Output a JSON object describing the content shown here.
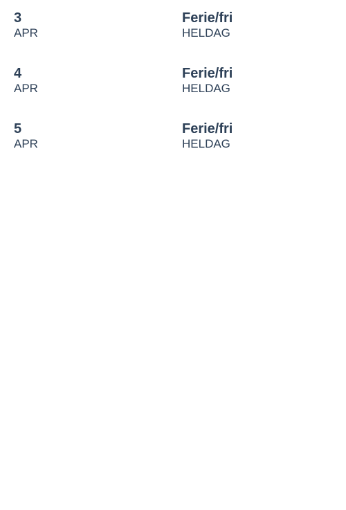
{
  "colors": {
    "text": "#2d4057",
    "background": "#ffffff"
  },
  "entries": [
    {
      "day": "3",
      "month": "APR",
      "title": "Ferie/fri",
      "duration": "HELDAG"
    },
    {
      "day": "4",
      "month": "APR",
      "title": "Ferie/fri",
      "duration": "HELDAG"
    },
    {
      "day": "5",
      "month": "APR",
      "title": "Ferie/fri",
      "duration": "HELDAG"
    }
  ]
}
